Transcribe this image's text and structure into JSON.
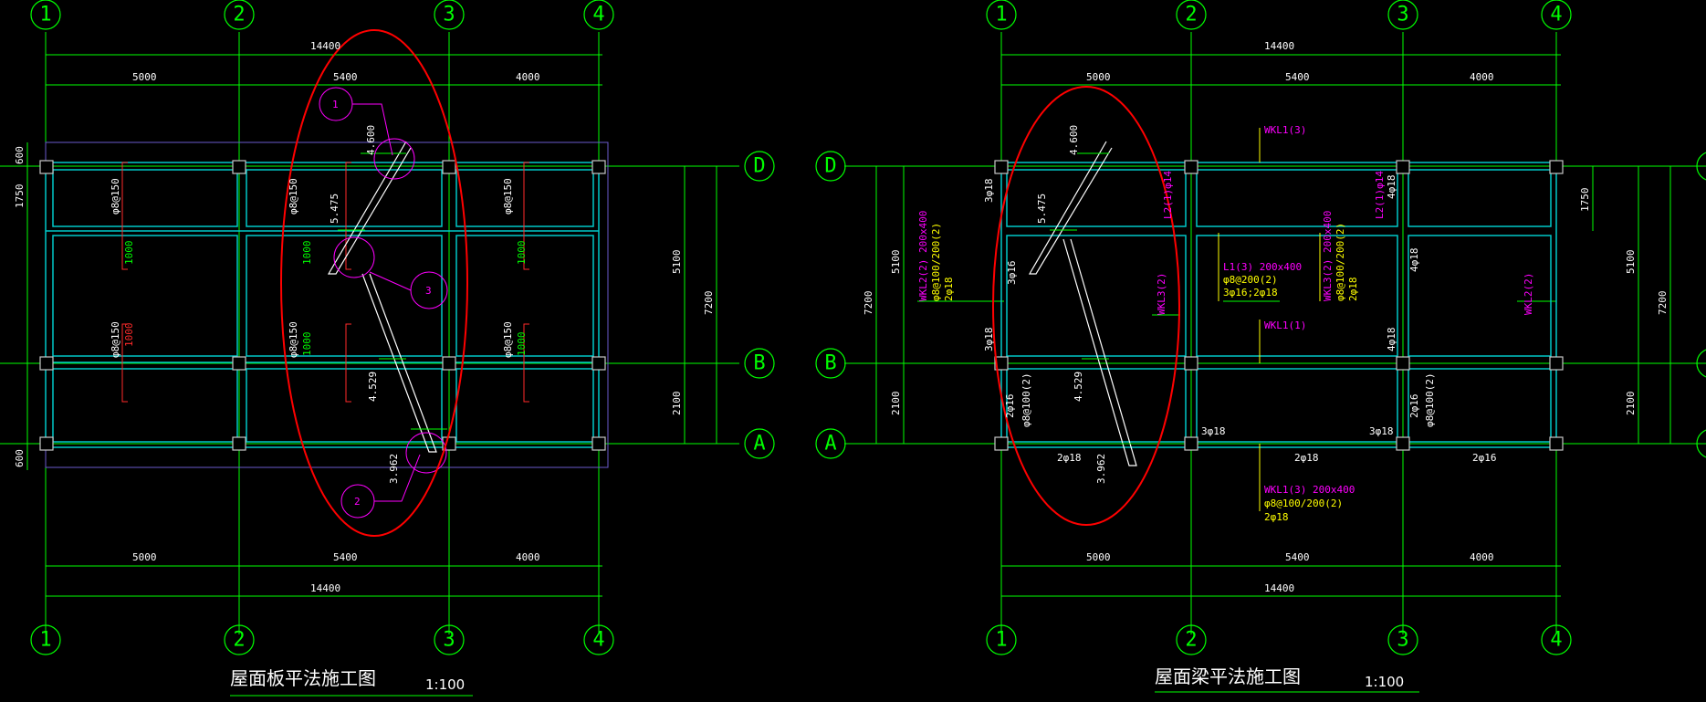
{
  "drawings": {
    "left": {
      "title": "屋面板平法施工图",
      "scale": "1:100",
      "grid_labels": [
        "1",
        "2",
        "3",
        "4"
      ],
      "row_labels": [
        "D",
        "B",
        "A"
      ],
      "dims_top_total": "14400",
      "dims_spans": [
        "5000",
        "5400",
        "4000"
      ],
      "dims_bottom_total": "14400",
      "dims_right": [
        "5100",
        "2100"
      ],
      "dims_right_total": "7200",
      "dims_left": [
        "600",
        "1750",
        "600"
      ],
      "rebar": [
        "φ8@150",
        "φ8@150",
        "φ8@150",
        "φ8@150",
        "φ8@150",
        "φ8@150"
      ],
      "rebar_len": [
        "1000",
        "1000",
        "1000",
        "1000",
        "1000",
        "1000"
      ],
      "elevations": [
        "4.600",
        "5.475",
        "4.529",
        "3.962"
      ],
      "callouts": [
        "1",
        "2",
        "3"
      ]
    },
    "right": {
      "title": "屋面梁平法施工图",
      "scale": "1:100",
      "grid_labels": [
        "1",
        "2",
        "3",
        "4"
      ],
      "row_labels": [
        "D",
        "B",
        "A"
      ],
      "dims_top_total": "14400",
      "dims_spans": [
        "5000",
        "5400",
        "4000"
      ],
      "dims_bottom_total": "14400",
      "dims_right": [
        "5100",
        "2100"
      ],
      "dims_right_total": "7200",
      "dims_left": [
        "5100",
        "2100"
      ],
      "dims_left_total": "7200",
      "dim_right_small": "1750",
      "elevations": [
        "4.600",
        "5.475",
        "4.529",
        "3.962"
      ],
      "beams": {
        "wkl1_top": "WKL1(3)",
        "wkl1_mid": "WKL1(1)",
        "l2_a": "L2(1)φ14",
        "l2_b": "L2(1)φ14",
        "wkl2_a": [
          "WKL2(2) 200x400",
          "φ8@100/200(2)",
          "2φ18"
        ],
        "wkl3": [
          "WKL3(2) 200x400",
          "φ8@100/200(2)",
          "2φ18"
        ],
        "wkl3_side": "WKL3(2)",
        "wkl2_side": "WKL2(2)",
        "l1": [
          "L1(3) 200x400",
          "φ8@200(2)",
          "3φ16;2φ18"
        ],
        "wkl1_bottom": [
          "WKL1(3) 200x400",
          "φ8@100/200(2)",
          "2φ18"
        ]
      },
      "bars": {
        "b3f18_top": "3φ18",
        "b3f16": "3φ16",
        "b3f18_side": "3φ18",
        "b4f18a": "4φ18",
        "b4f18b": "4φ18",
        "b4f18c": "4φ18",
        "b2f16_left": "2φ16",
        "stir_left": "φ8@100(2)",
        "b2f16_right": "2φ16",
        "stir_right": "φ8@100(2)",
        "bot_2f18a": "2φ18",
        "bot_3f18a": "3φ18",
        "bot_2f18b": "2φ18",
        "bot_3f18b": "3φ18",
        "bot_2f16": "2φ16"
      }
    }
  },
  "colors": {
    "grid": "#00ff00",
    "slab": "#00ffff",
    "beam_label": "#ff00ff",
    "beam_text": "#ffff00",
    "highlight": "#ff0000",
    "dim": "#ffffff"
  }
}
